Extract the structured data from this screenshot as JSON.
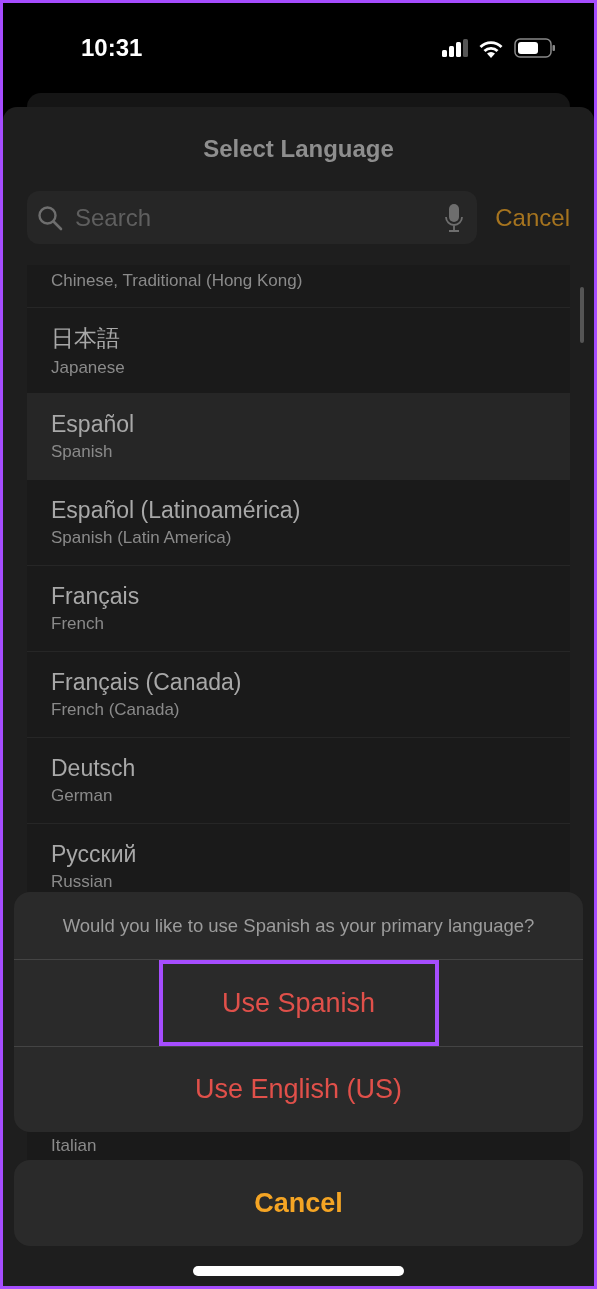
{
  "status_bar": {
    "time": "10:31"
  },
  "sheet": {
    "title": "Select Language",
    "search": {
      "placeholder": "Search"
    },
    "cancel": "Cancel"
  },
  "languages": [
    {
      "subtitle": "Chinese, Traditional (Hong Kong)",
      "selected": false,
      "kind": "cut"
    },
    {
      "title": "日本語",
      "subtitle": "Japanese",
      "selected": false,
      "kind": "full"
    },
    {
      "title": "Español",
      "subtitle": "Spanish",
      "selected": true,
      "kind": "full"
    },
    {
      "title": "Español (Latinoamérica)",
      "subtitle": "Spanish (Latin America)",
      "selected": false,
      "kind": "full"
    },
    {
      "title": "Français",
      "subtitle": "French",
      "selected": false,
      "kind": "full"
    },
    {
      "title": "Français (Canada)",
      "subtitle": "French (Canada)",
      "selected": false,
      "kind": "full"
    },
    {
      "title": "Deutsch",
      "subtitle": "German",
      "selected": false,
      "kind": "full"
    },
    {
      "title": "Русский",
      "subtitle": "Russian",
      "selected": false,
      "kind": "full"
    },
    {
      "subtitle": "Italian",
      "selected": false,
      "kind": "covered"
    }
  ],
  "action_sheet": {
    "message": "Would you like to use Spanish as your primary language?",
    "actions": [
      {
        "label": "Use Spanish",
        "highlighted": true
      },
      {
        "label": "Use English (US)",
        "highlighted": false
      }
    ],
    "cancel": "Cancel"
  }
}
